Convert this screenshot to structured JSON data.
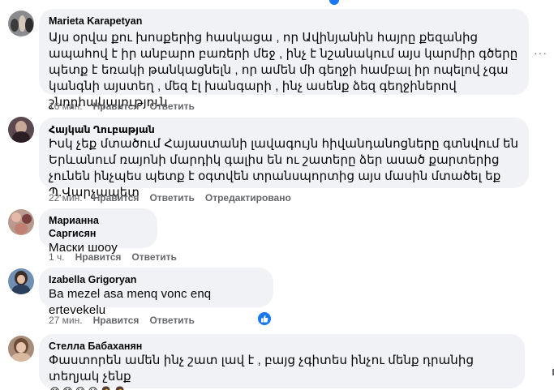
{
  "comments": [
    {
      "author": "Marieta Karapetyan",
      "text": "Այս օրվա քու խոսքերից հասկացա , որ Ավինյանին հայրը քեզանից ապահով է իր անբարո բառերի մեջ , ինչ է նշանակում այս կարմիր գծերը պետք է եռակի թանկացնելն , որ ամեն մի գեղջի համբալ իր ոպելով չգա կանգնի այստեղ , մեզ էլ խանգարի , ինչ ասենք ձեզ գեղջիներով շնորհակալություն",
      "time": "16 мин.",
      "like": "Нравится",
      "reply": "Ответить",
      "edited": ""
    },
    {
      "author": "Հայկան Ղուբաթյան",
      "text": "Իսկ չեք մտածում Հայաստանի լավագույն հիվանդանոցները գտնվում են Երևանում ռայոնի մարդիկ գալիս են ու շատերը ձեր ասած քարտերից չունեն ինչպես պետք է օգտվեն տրանսպորտից այս մասին մտածել եք Պ.Վարչապետ",
      "time": "22 мин.",
      "like": "Нравится",
      "reply": "Ответить",
      "edited": "Отредактировано"
    },
    {
      "author": "Марианна Саргисян",
      "text": "Маски шоoу",
      "time": "1 ч.",
      "like": "Нравится",
      "reply": "Ответить",
      "edited": ""
    },
    {
      "author": "Izabella Grigoryan",
      "text": "Ba mezel asa menq vonc enq ertevekelu",
      "time": "27 мин.",
      "like": "Нравится",
      "reply": "Ответить",
      "edited": ""
    },
    {
      "author": "Стелла Бабаханян",
      "text": "Փաստորեն ամեն ինչ շատ լավ է , բայց չգիտես ինչու մենք դրանից տեղյակ չենք",
      "emojis": "😂😂😭😭🤦‍♀️🤦‍♀️:",
      "time": "",
      "like": "",
      "reply": "",
      "edited": ""
    }
  ],
  "more_icon": "···",
  "colors": {
    "bubble": "#f0f2f5",
    "meta": "#65676b",
    "like_blue": "#1877f2"
  }
}
